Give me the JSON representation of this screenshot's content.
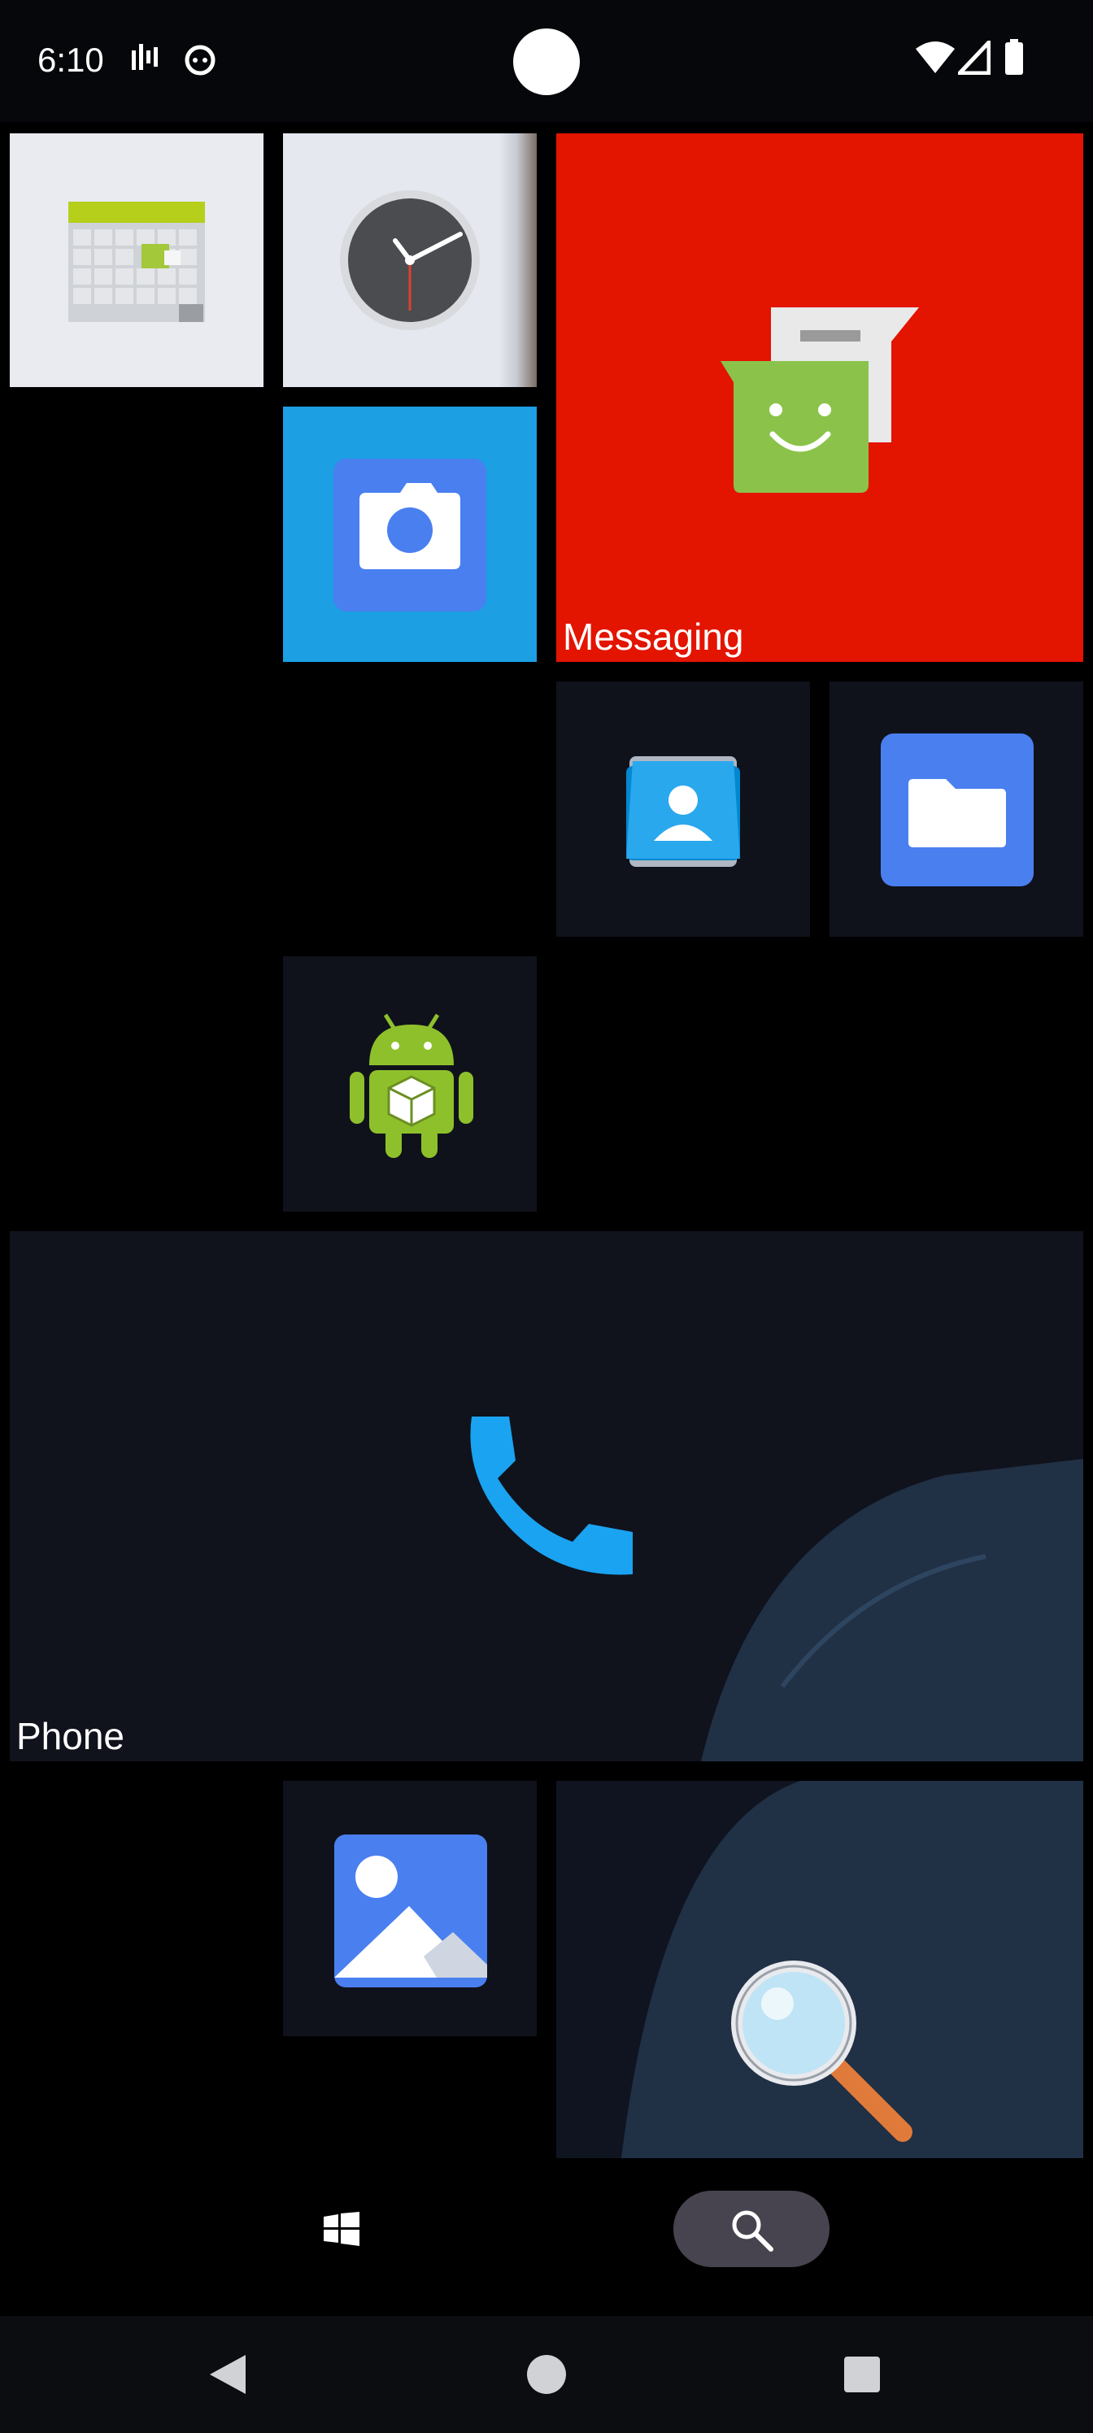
{
  "status_bar": {
    "time": "6:10",
    "icons": [
      "signal-bars-icon",
      "notification-face-icon",
      "wifi-icon",
      "cellular-icon",
      "battery-icon"
    ]
  },
  "tiles": {
    "calendar": {
      "icon": "calendar-icon",
      "label": ""
    },
    "clock": {
      "icon": "clock-icon",
      "label": ""
    },
    "messaging": {
      "icon": "messaging-icon",
      "label": "Messaging",
      "color": "#e31400"
    },
    "camera": {
      "icon": "camera-icon",
      "label": "",
      "color": "#1c9fe3"
    },
    "contacts": {
      "icon": "contacts-icon",
      "label": ""
    },
    "files": {
      "icon": "folder-icon",
      "label": ""
    },
    "android_app": {
      "icon": "android-package-icon",
      "label": ""
    },
    "phone": {
      "icon": "phone-icon",
      "label": "Phone"
    },
    "gallery": {
      "icon": "gallery-icon",
      "label": ""
    },
    "search": {
      "icon": "magnifier-icon",
      "label": ""
    }
  },
  "taskbar": {
    "start_icon": "windows-logo-icon",
    "search_icon": "search-icon"
  },
  "nav_bar": {
    "back": "back-icon",
    "home": "home-icon",
    "recents": "recents-icon"
  }
}
